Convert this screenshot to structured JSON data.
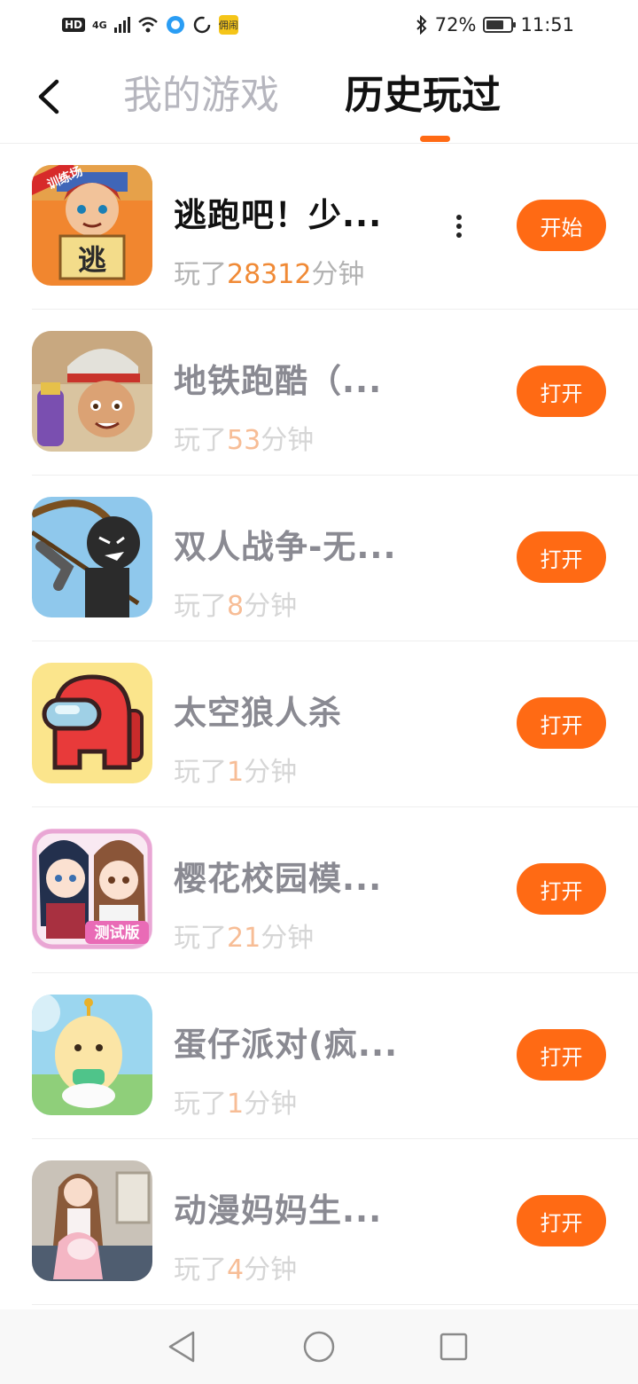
{
  "status_bar": {
    "hd": "HD",
    "network": "4G",
    "battery": "72%",
    "battery_level": 0.72,
    "time": "11:51",
    "notification_app_label": "佣闹"
  },
  "header": {
    "tab_inactive": "我的游戏",
    "tab_active": "历史玩过"
  },
  "games": [
    {
      "title": "逃跑吧！少...",
      "played_prefix": "玩了",
      "minutes": "28312",
      "unit": "分钟",
      "button": "开始",
      "icon": "escape-game-icon",
      "icon_banner": "训练场",
      "icon_sign": "逃"
    },
    {
      "title": "地铁跑酷（...",
      "played_prefix": "玩了",
      "minutes": "53",
      "unit": "分钟",
      "button": "打开",
      "icon": "subway-surfers-icon"
    },
    {
      "title": "双人战争-无...",
      "played_prefix": "玩了",
      "minutes": "8",
      "unit": "分钟",
      "button": "打开",
      "icon": "stickman-archer-icon"
    },
    {
      "title": "太空狼人杀",
      "played_prefix": "玩了",
      "minutes": "1",
      "unit": "分钟",
      "button": "打开",
      "icon": "crewmate-icon"
    },
    {
      "title": "樱花校园模...",
      "played_prefix": "玩了",
      "minutes": "21",
      "unit": "分钟",
      "button": "打开",
      "icon": "sakura-school-icon",
      "icon_badge": "测试版"
    },
    {
      "title": "蛋仔派对(疯...",
      "played_prefix": "玩了",
      "minutes": "1",
      "unit": "分钟",
      "button": "打开",
      "icon": "eggy-party-icon"
    },
    {
      "title": "动漫妈妈生...",
      "played_prefix": "玩了",
      "minutes": "4",
      "unit": "分钟",
      "button": "打开",
      "icon": "anime-mom-icon"
    }
  ],
  "colors": {
    "accent": "#ff6a14",
    "title_active": "#111111",
    "title_muted": "#8a8a92",
    "minutes_active": "#f08a36",
    "minutes_muted": "#f7bd96"
  },
  "nav": {
    "back": "back-triangle-icon",
    "home": "home-circle-icon",
    "recents": "recents-square-icon"
  }
}
